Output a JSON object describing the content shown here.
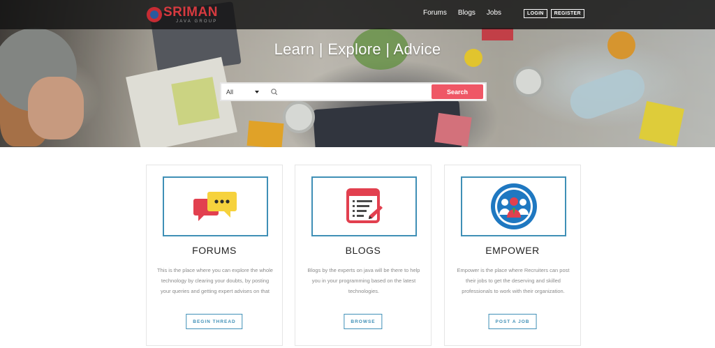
{
  "brand": {
    "name": "SRIMAN",
    "sub": "JAVA GROUP"
  },
  "nav": {
    "links": [
      {
        "label": "Forums"
      },
      {
        "label": "Blogs"
      },
      {
        "label": "Jobs"
      }
    ],
    "login_label": "LOGIN",
    "register_label": "REGISTER"
  },
  "hero": {
    "title": "Learn | Explore | Advice",
    "search": {
      "category": "All",
      "placeholder": "",
      "button_label": "Search"
    }
  },
  "cards": [
    {
      "title": "FORUMS",
      "description": "This is the place where you can explore the whole technology by clearing your doubts, by posting your queries and getting expert advises on that",
      "button_label": "BEGIN THREAD",
      "icon": "chat-bubbles-icon"
    },
    {
      "title": "BLOGS",
      "description": "Blogs by the experts on java will be there to help you in your programming based on the latest technologies.",
      "button_label": "BROWSE",
      "icon": "blog-document-icon"
    },
    {
      "title": "EMPOWER",
      "description": "Empower is the place where Recruiters can post their jobs to get the deserving and skilled professionals to work with their organization.",
      "button_label": "POST A JOB",
      "icon": "people-group-icon"
    }
  ],
  "colors": {
    "accent_blue": "#3f8fb6",
    "search_red": "#ef5766",
    "brand_red": "#d63a3f"
  }
}
